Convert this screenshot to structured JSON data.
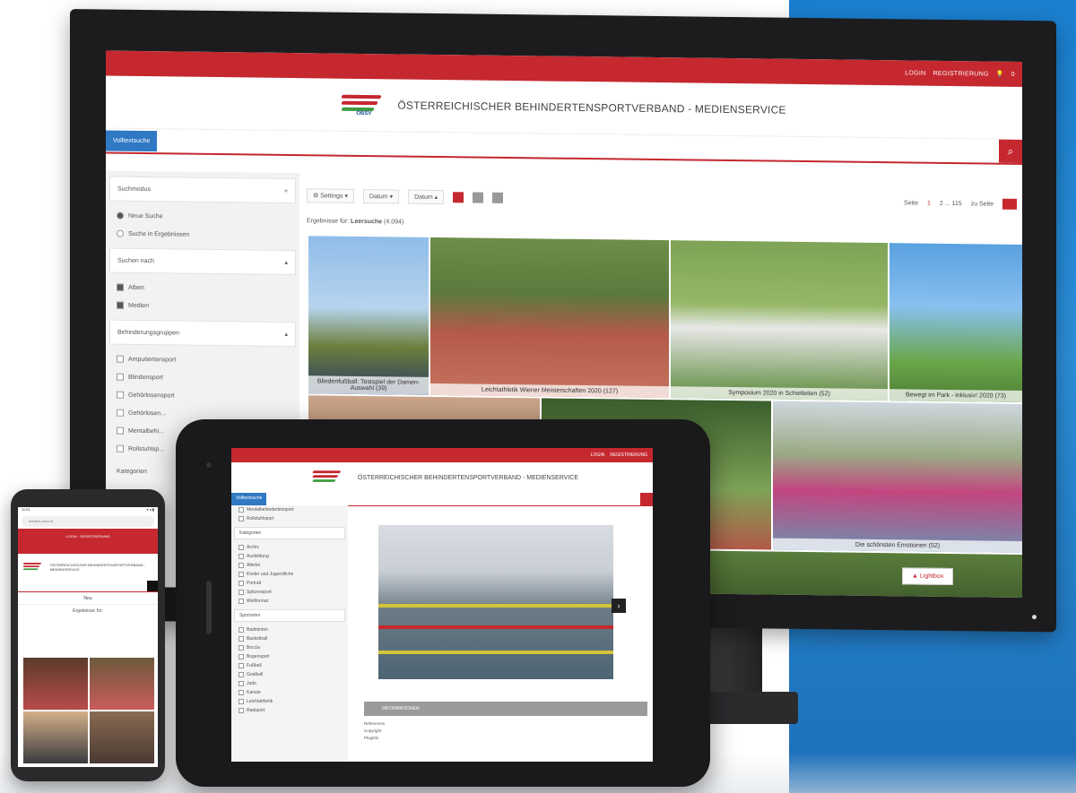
{
  "monitor": {
    "topbar": {
      "login": "LOGIN",
      "register": "REGISTRIERUNG",
      "lightbox_count": "0"
    },
    "header": {
      "logo_text": "ÖBSV",
      "site_title": "ÖSTERREICHISCHER BEHINDERTENSPORTVERBAND - MEDIENSERVICE"
    },
    "search": {
      "label": "Volltextsuche"
    },
    "sidebar": {
      "search_mode_title": "Suchmodus",
      "search_mode_options": [
        "Neue Suche",
        "Suche in Ergebnissen"
      ],
      "search_for_title": "Suchen nach",
      "search_for_options": [
        "Alben",
        "Medien"
      ],
      "groups_title": "Behinderungsgruppen",
      "groups": [
        "Amputiertensport",
        "Blindensport",
        "Gehörlosensport",
        "Gehörlosen...",
        "Mentalbehi...",
        "Rollstuhlsp..."
      ],
      "categories_title": "Kategorien"
    },
    "toolbar": {
      "settings": "Settings",
      "sort1": "Datum",
      "sort2": "Datum",
      "page_label": "Seite",
      "page_current": "1",
      "page_range": "2 ... 115",
      "goto_label": "zu Seite"
    },
    "results": {
      "prefix": "Ergebnisse für:",
      "query": "Leersuche",
      "count": "(4.094)"
    },
    "tiles": [
      {
        "caption": "Blindenfußball: Testspiel der Damen-Auswahl (39)"
      },
      {
        "caption": "Leichtathletik Wiener Meisterschaften 2020 (127)"
      },
      {
        "caption": "Symposium 2020 in Schielleiten (52)"
      },
      {
        "caption": "Bewegt im Park - inklusiv! 2020 (73)"
      },
      {
        "caption": ""
      },
      {
        "caption": ""
      },
      {
        "caption": "Die schönsten Emotionen (52)"
      }
    ],
    "lightbox_button": "Lightbox"
  },
  "tablet": {
    "topbar": {
      "login": "LOGIN",
      "register": "REGISTRIERUNG"
    },
    "title": "ÖSTERREICHISCHER BEHINDERTENSPORTVERBAND - MEDIENSERVICE",
    "search_label": "Volltextsuche",
    "sidebar": {
      "top_items": [
        "Mentalbehindertensport",
        "Rollstuhlsport"
      ],
      "categories_title": "Kategorien",
      "categories": [
        "Archiv",
        "Ausbildung",
        "Allerlei",
        "Kinder und Jugendliche",
        "Portrait",
        "Spitzensport",
        "Weltformat"
      ],
      "sports_title": "Sportarten",
      "sports": [
        "Badminton",
        "Basketball",
        "Boccia",
        "Bogensport",
        "Fußball",
        "Goalball",
        "Judo",
        "Kanute",
        "Leichtathletik",
        "Radsport"
      ]
    },
    "info_title": "INFORMATIONEN",
    "meta": [
      "Referenzen",
      "Copyright",
      "Pluginfo"
    ]
  },
  "phone": {
    "status": {
      "time": "11:51",
      "icons": "▾ ◂ ▮"
    },
    "url": "medien.obsv.at",
    "topbar": "LOGIN · REGISTRIERUNG",
    "title": "ÖSTERREICHISCHER BEHINDERTENSPORTVERBAND - MEDIENSERVICE",
    "sub": "Neu",
    "results": "Ergebnisse für:"
  },
  "colors": {
    "brand_red": "#c5282f",
    "accent_blue": "#2f78c4",
    "bg_blue": "#1a7fd0"
  }
}
